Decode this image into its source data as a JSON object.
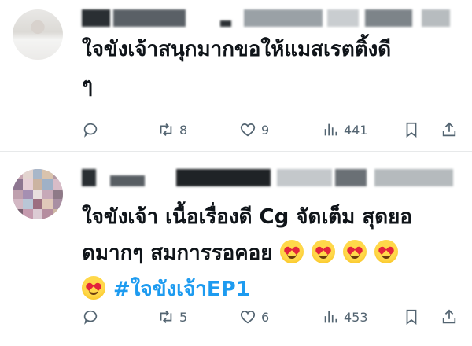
{
  "tweets": [
    {
      "text_lines": [
        "ใจขังเจ้าสนุกมากขอให้แมสเรตติ้งดี",
        "ๆ"
      ],
      "counts": {
        "replies": "",
        "retweets": "8",
        "likes": "9",
        "views": "441"
      }
    },
    {
      "text_lines": [
        "ใจขังเจ้า เนื้อเรื่องดี Cg จัดเต็ม สุดยอ",
        "ดมากๆ สมการรอคอย"
      ],
      "hashtag": "#ใจขังเจ้าEP1",
      "emoji_count_line2": 4,
      "emoji_count_line3": 1,
      "counts": {
        "replies": "",
        "retweets": "5",
        "likes": "6",
        "views": "453"
      }
    }
  ],
  "icons": [
    "reply-icon",
    "retweet-icon",
    "like-icon",
    "views-icon",
    "bookmark-icon",
    "share-icon"
  ],
  "colors": {
    "text": "#0f1419",
    "muted": "#536471",
    "hashtag": "#1d9bf0",
    "divider": "#e7e9ea"
  }
}
